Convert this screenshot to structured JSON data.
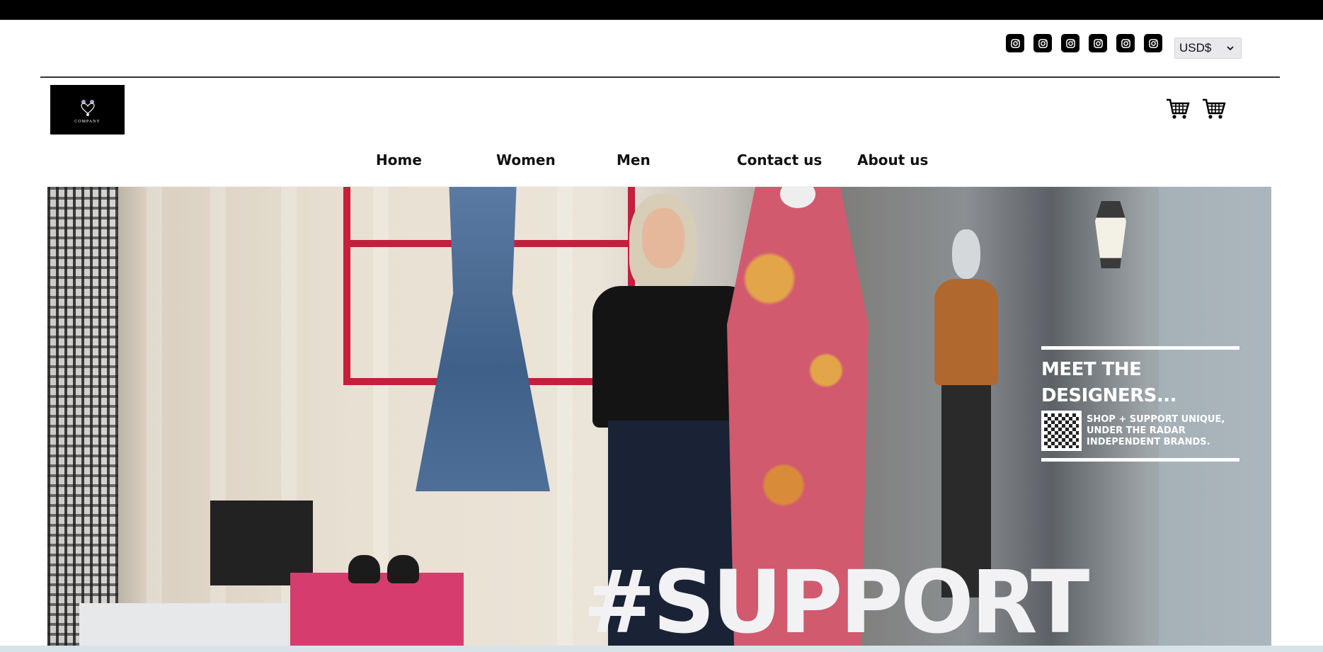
{
  "social": {
    "icons": [
      "instagram-icon",
      "instagram-icon",
      "instagram-icon",
      "instagram-icon",
      "instagram-icon",
      "instagram-icon"
    ]
  },
  "currency": {
    "selected": "USD$"
  },
  "logo": {
    "text": "COMPANY"
  },
  "nav": {
    "items": [
      {
        "label": "Home"
      },
      {
        "label": "Women"
      },
      {
        "label": "Men"
      },
      {
        "label": "Contact us"
      },
      {
        "label": "About us"
      }
    ]
  },
  "hero": {
    "headline_line1": "MEET THE",
    "headline_line2": "DESIGNERS...",
    "sub_line1": "SHOP + SUPPORT UNIQUE,",
    "sub_line2": "UNDER THE RADAR",
    "sub_line3": "INDEPENDENT BRANDS.",
    "big_text": "#SUPPORT"
  },
  "colors": {
    "topbar": "#000000",
    "accent_red": "#c41f3d",
    "pink": "#d63c6e"
  }
}
